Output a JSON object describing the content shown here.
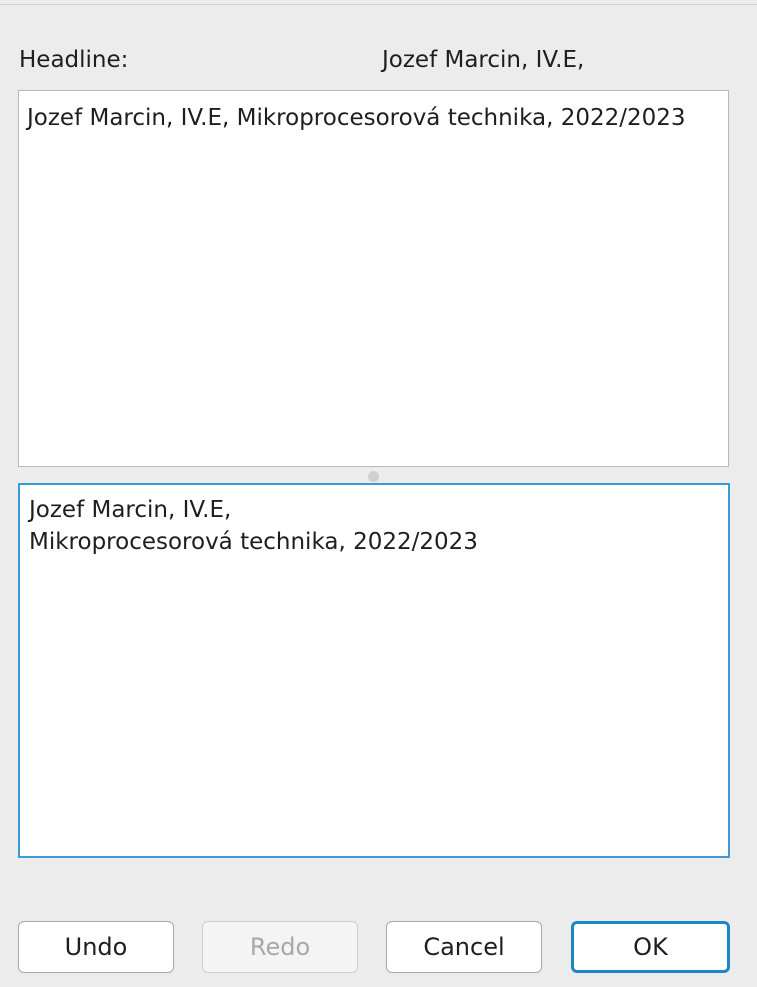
{
  "dialog": {
    "headline_label": "Headline:",
    "headline_value": "Jozef Marcin, IV.E,",
    "preview_text": "Jozef Marcin, IV.E, Mikroprocesorová technika, 2022/2023",
    "edit_text": "Jozef Marcin, IV.E,\nMikroprocesorová technika, 2022/2023"
  },
  "buttons": {
    "undo": "Undo",
    "redo": "Redo",
    "cancel": "Cancel",
    "ok": "OK"
  },
  "colors": {
    "focus_accent": "#3a9bd6",
    "default_button_border": "#1d86c8",
    "disabled_text": "#a8a8a8"
  },
  "state": {
    "redo_enabled": false,
    "focused_field": "edit-text-area",
    "default_button": "ok-button"
  }
}
